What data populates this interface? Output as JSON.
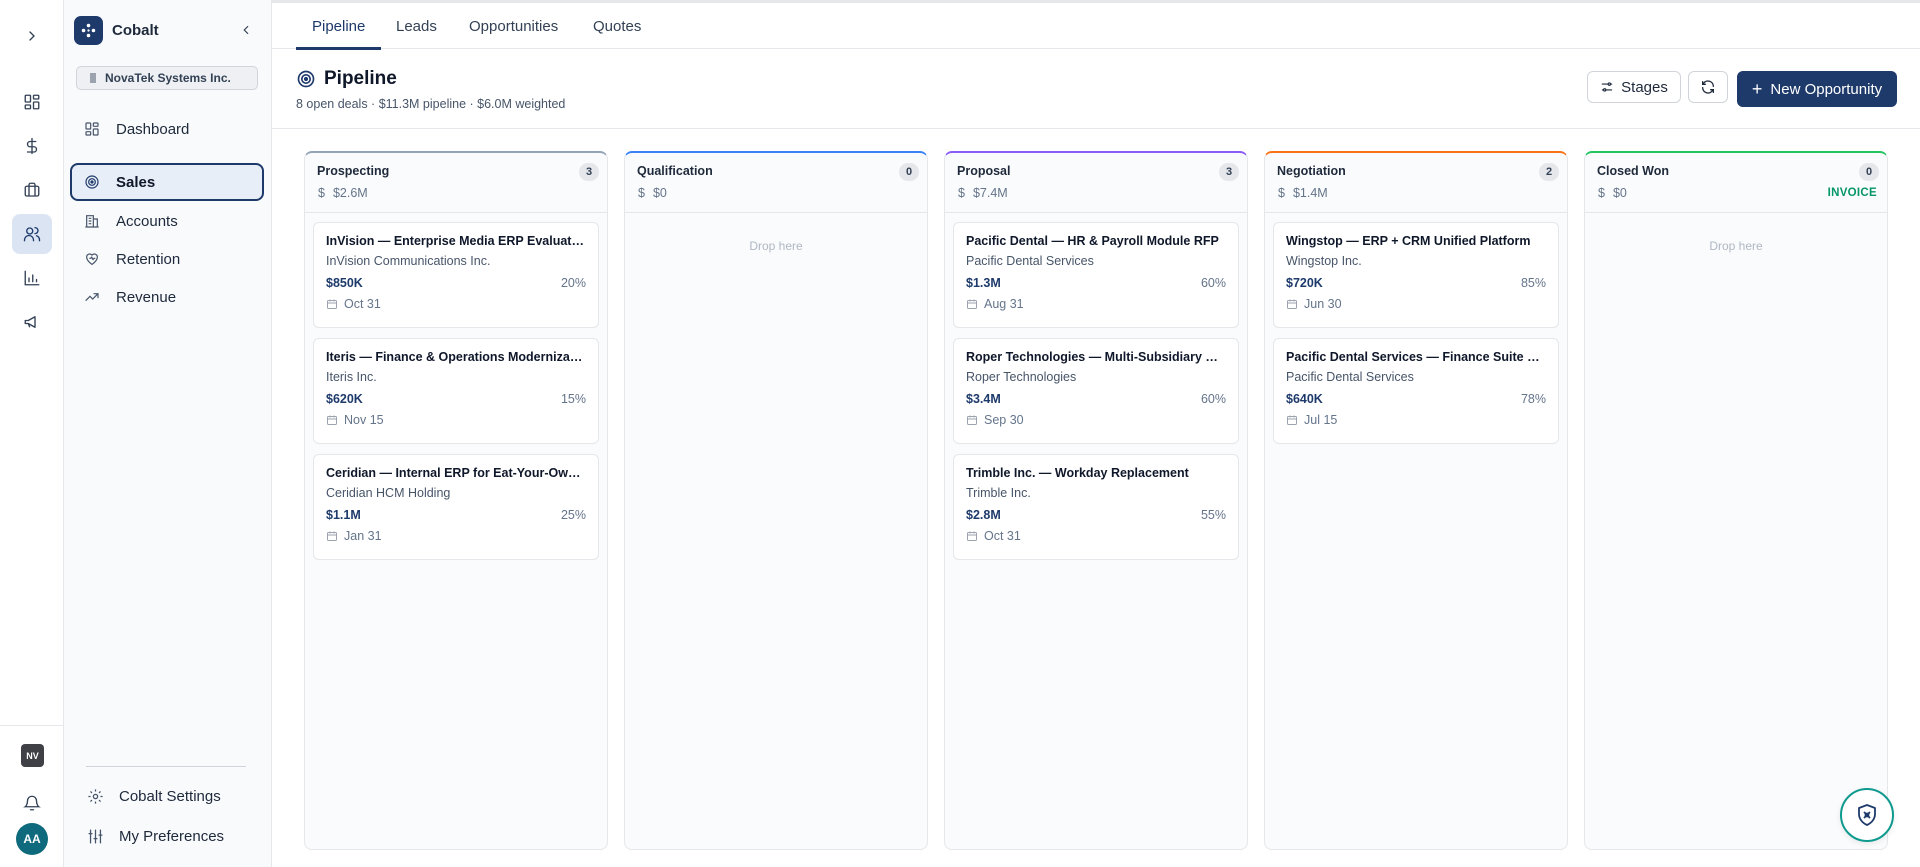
{
  "app": {
    "name": "Cobalt",
    "org": "NovaTek Systems Inc."
  },
  "rail": {
    "items": [
      {
        "icon": "dashboard-grid-icon"
      },
      {
        "icon": "dollar-icon"
      },
      {
        "icon": "briefcase-icon"
      },
      {
        "icon": "users-icon",
        "active": true
      },
      {
        "icon": "bar-chart-icon"
      },
      {
        "icon": "megaphone-icon"
      }
    ],
    "workspace_badge": "NV",
    "avatar": "AA"
  },
  "sidebar": {
    "items": [
      {
        "label": "Dashboard",
        "icon": "dashboard-icon"
      },
      {
        "label": "Sales",
        "icon": "target-icon",
        "active": true
      },
      {
        "label": "Accounts",
        "icon": "building-icon"
      },
      {
        "label": "Retention",
        "icon": "heart-icon"
      },
      {
        "label": "Revenue",
        "icon": "trending-up-icon"
      }
    ],
    "footer": [
      {
        "label": "Cobalt Settings",
        "icon": "gear-icon"
      },
      {
        "label": "My Preferences",
        "icon": "sliders-icon"
      }
    ]
  },
  "tabs": [
    {
      "label": "Pipeline",
      "active": true
    },
    {
      "label": "Leads"
    },
    {
      "label": "Opportunities"
    },
    {
      "label": "Quotes"
    }
  ],
  "header": {
    "title": "Pipeline",
    "subtitle": "8 open deals · $11.3M pipeline · $6.0M weighted",
    "stages_label": "Stages",
    "new_label": "New Opportunity"
  },
  "colors": {
    "accent": "#1e3a6b",
    "prospecting": "#94a3b8",
    "qualification": "#3b82f6",
    "proposal": "#8b5cf6",
    "negotiation": "#f97316",
    "closed_won": "#22c55e"
  },
  "stages": [
    {
      "name": "Prospecting",
      "count": "3",
      "amount": "$2.6M",
      "cards": [
        {
          "title": "InVision — Enterprise Media ERP Evaluation",
          "company": "InVision Communications Inc.",
          "amount": "$850K",
          "prob": "20%",
          "date": "Oct 31"
        },
        {
          "title": "Iteris — Finance & Operations Modernization",
          "company": "Iteris Inc.",
          "amount": "$620K",
          "prob": "15%",
          "date": "Nov 15"
        },
        {
          "title": "Ceridian — Internal ERP for Eat-Your-Own-Dog-Food",
          "company": "Ceridian HCM Holding",
          "amount": "$1.1M",
          "prob": "25%",
          "date": "Jan 31"
        }
      ]
    },
    {
      "name": "Qualification",
      "count": "0",
      "amount": "$0",
      "drop": "Drop here",
      "cards": []
    },
    {
      "name": "Proposal",
      "count": "3",
      "amount": "$7.4M",
      "cards": [
        {
          "title": "Pacific Dental — HR & Payroll Module RFP",
          "company": "Pacific Dental Services",
          "amount": "$1.3M",
          "prob": "60%",
          "date": "Aug 31"
        },
        {
          "title": "Roper Technologies — Multi-Subsidiary ERP Consolidation",
          "company": "Roper Technologies",
          "amount": "$3.4M",
          "prob": "60%",
          "date": "Sep 30"
        },
        {
          "title": "Trimble Inc. — Workday Replacement",
          "company": "Trimble Inc.",
          "amount": "$2.8M",
          "prob": "55%",
          "date": "Oct 31"
        }
      ]
    },
    {
      "name": "Negotiation",
      "count": "2",
      "amount": "$1.4M",
      "cards": [
        {
          "title": "Wingstop — ERP + CRM Unified Platform",
          "company": "Wingstop Inc.",
          "amount": "$720K",
          "prob": "85%",
          "date": "Jun 30"
        },
        {
          "title": "Pacific Dental Services — Finance Suite Pilot",
          "company": "Pacific Dental Services",
          "amount": "$640K",
          "prob": "78%",
          "date": "Jul 15"
        }
      ]
    },
    {
      "name": "Closed Won",
      "count": "0",
      "amount": "$0",
      "badge": "INVOICE",
      "drop": "Drop here",
      "cards": []
    }
  ]
}
